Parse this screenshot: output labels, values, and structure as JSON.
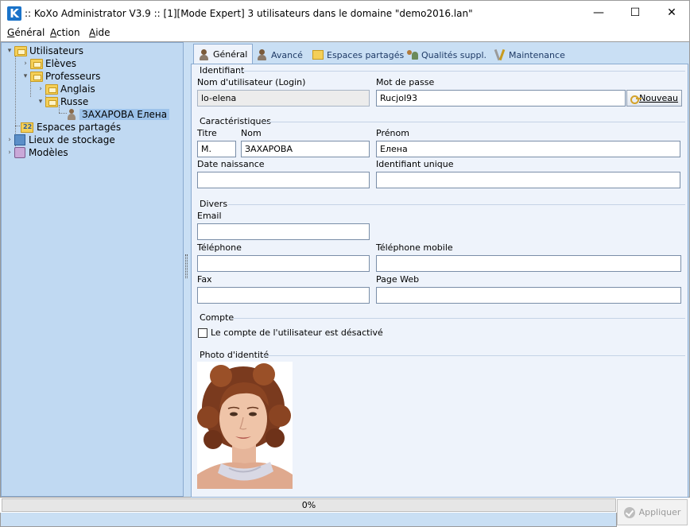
{
  "window": {
    "title": ":: KoXo Administrator V3.9 :: [1][Mode Expert] 3 utilisateurs dans le domaine \"demo2016.lan\"",
    "app_icon_letter": "K",
    "minimize_glyph": "—",
    "maximize_glyph": "☐",
    "close_glyph": "✕"
  },
  "menu": {
    "items": [
      {
        "accel": "G",
        "rest": "énéral"
      },
      {
        "accel": "A",
        "rest": "ction"
      },
      {
        "accel": "A",
        "rest": "ide"
      }
    ]
  },
  "tree": {
    "nodes": [
      {
        "label": "Utilisateurs",
        "arrow": "▾",
        "icon": "folder-icon"
      },
      {
        "label": "Elèves",
        "arrow": "›",
        "icon": "folder-icon"
      },
      {
        "label": "Professeurs",
        "arrow": "▾",
        "icon": "folder-icon"
      },
      {
        "label": "Anglais",
        "arrow": "›",
        "icon": "folder-icon"
      },
      {
        "label": "Russe",
        "arrow": "▾",
        "icon": "folder-icon"
      },
      {
        "label": "ЗАХАРОВА Елена",
        "arrow": "",
        "icon": "user-icon"
      },
      {
        "label": "Espaces partagés",
        "arrow": "",
        "icon": "share-icon"
      },
      {
        "label": "Lieux de stockage",
        "arrow": "›",
        "icon": "storage-icon"
      },
      {
        "label": "Modèles",
        "arrow": "›",
        "icon": "model-icon"
      }
    ]
  },
  "tabs": [
    {
      "label": "Général",
      "icon": "user-icon",
      "active": true
    },
    {
      "label": "Avancé",
      "icon": "user-icon",
      "active": false
    },
    {
      "label": "Espaces partagés",
      "icon": "share-icon",
      "active": false
    },
    {
      "label": "Qualités suppl.",
      "icon": "users-icon",
      "active": false
    },
    {
      "label": "Maintenance",
      "icon": "tools-icon",
      "active": false
    }
  ],
  "form": {
    "identifiant": {
      "section": "Identifiant",
      "login_label": "Nom d'utilisateur (Login)",
      "login_value": "lo-elena",
      "password_label": "Mot de passe",
      "password_value": "Rucjol93",
      "new_button": "Nouveau"
    },
    "caracteristiques": {
      "section": "Caractéristiques",
      "title_label": "Titre",
      "title_value": "M.",
      "name_label": "Nom",
      "name_value": "ЗАХАРОВА",
      "firstname_label": "Prénom",
      "firstname_value": "Елена",
      "birthdate_label": "Date naissance",
      "birthdate_value": "",
      "uid_label": "Identifiant unique",
      "uid_value": ""
    },
    "divers": {
      "section": "Divers",
      "email_label": "Email",
      "email_value": "",
      "phone_label": "Téléphone",
      "phone_value": "",
      "mobile_label": "Téléphone mobile",
      "mobile_value": "",
      "fax_label": "Fax",
      "fax_value": "",
      "web_label": "Page Web",
      "web_value": ""
    },
    "compte": {
      "section": "Compte",
      "disabled_label": "Le compte de l'utilisateur est désactivé",
      "disabled_checked": false
    },
    "photo": {
      "section": "Photo d'identité"
    }
  },
  "bottom": {
    "progress_text": "0%",
    "progress_value": 0,
    "apply_button": "Appliquer"
  }
}
